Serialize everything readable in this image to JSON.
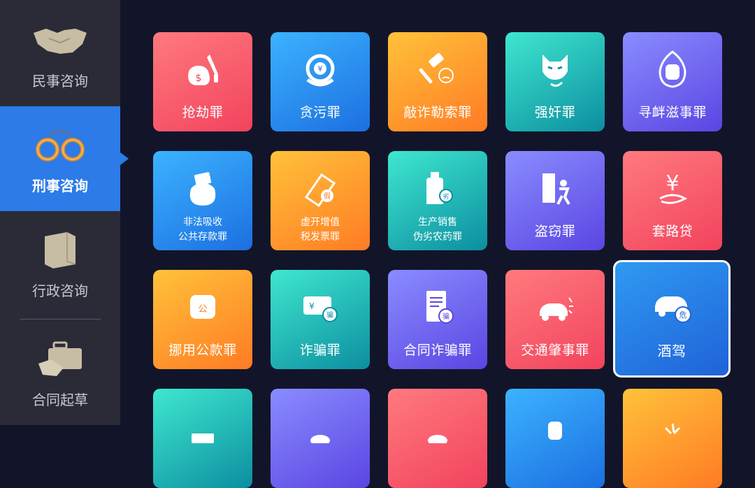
{
  "sidebar": {
    "items": [
      {
        "label": "民事咨询",
        "icon": "handshake-icon"
      },
      {
        "label": "刑事咨询",
        "icon": "handcuffs-icon"
      },
      {
        "label": "行政咨询",
        "icon": "building-icon"
      },
      {
        "label": "合同起草",
        "icon": "briefcase-icon"
      }
    ],
    "active_index": 1,
    "colors": {
      "background": "#2a2b36",
      "active": "#2c7be8"
    }
  },
  "tiles": [
    {
      "label": "抢劫罪",
      "icon": "money-bag-knife-icon",
      "color": "red"
    },
    {
      "label": "贪污罪",
      "icon": "money-hand-icon",
      "color": "blue"
    },
    {
      "label": "敲诈勒索罪",
      "icon": "hammer-face-icon",
      "color": "orange"
    },
    {
      "label": "强奸罪",
      "icon": "wolf-icon",
      "color": "teal"
    },
    {
      "label": "寻衅滋事罪",
      "icon": "fist-flame-icon",
      "color": "purple"
    },
    {
      "label_lines": [
        "非法吸收",
        "公共存款罪"
      ],
      "icon": "money-bag-icon",
      "color": "blue"
    },
    {
      "label_lines": [
        "虚开增值",
        "税发票罪"
      ],
      "icon": "fake-invoice-icon",
      "color": "orange"
    },
    {
      "label_lines": [
        "生产销售",
        "伪劣农药罪"
      ],
      "icon": "pesticide-bottle-icon",
      "color": "teal"
    },
    {
      "label": "盗窃罪",
      "icon": "thief-door-icon",
      "color": "purple"
    },
    {
      "label": "套路贷",
      "icon": "yen-coil-icon",
      "color": "red"
    },
    {
      "label": "挪用公款罪",
      "icon": "fist-public-icon",
      "color": "orange"
    },
    {
      "label": "诈骗罪",
      "icon": "fraud-card-icon",
      "color": "teal"
    },
    {
      "label": "合同诈骗罪",
      "icon": "fraud-contract-icon",
      "color": "purple"
    },
    {
      "label": "交通肇事罪",
      "icon": "car-crash-icon",
      "color": "red"
    },
    {
      "label": "酒驾",
      "icon": "danger-car-icon",
      "color": "drive",
      "focused": true
    }
  ],
  "partial_row_colors": [
    "teal",
    "purple",
    "red",
    "blue",
    "orange"
  ]
}
